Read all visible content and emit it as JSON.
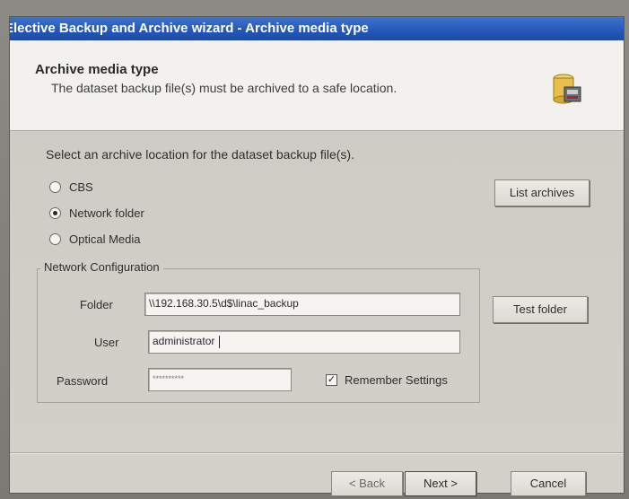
{
  "window": {
    "title": "Elective Backup and Archive wizard - Archive media type"
  },
  "header": {
    "title": "Archive media type",
    "subtitle": "The dataset backup file(s) must be archived to a safe location.",
    "icon": "archive-database-icon"
  },
  "content": {
    "prompt": "Select an archive location for the dataset backup file(s).",
    "options": [
      {
        "label": "CBS",
        "selected": false
      },
      {
        "label": "Network folder",
        "selected": true
      },
      {
        "label": "Optical Media",
        "selected": false
      }
    ],
    "list_archives_label": "List archives",
    "test_folder_label": "Test folder"
  },
  "network_config": {
    "group_label": "Network Configuration",
    "folder_label": "Folder",
    "folder_value": "\\\\192.168.30.5\\d$\\linac_backup",
    "user_label": "User",
    "user_value": "administrator",
    "password_label": "Password",
    "password_value": "**********",
    "remember_label": "Remember Settings",
    "remember_checked": true
  },
  "footer": {
    "back_label": "< Back",
    "next_label": "Next >",
    "cancel_label": "Cancel"
  }
}
